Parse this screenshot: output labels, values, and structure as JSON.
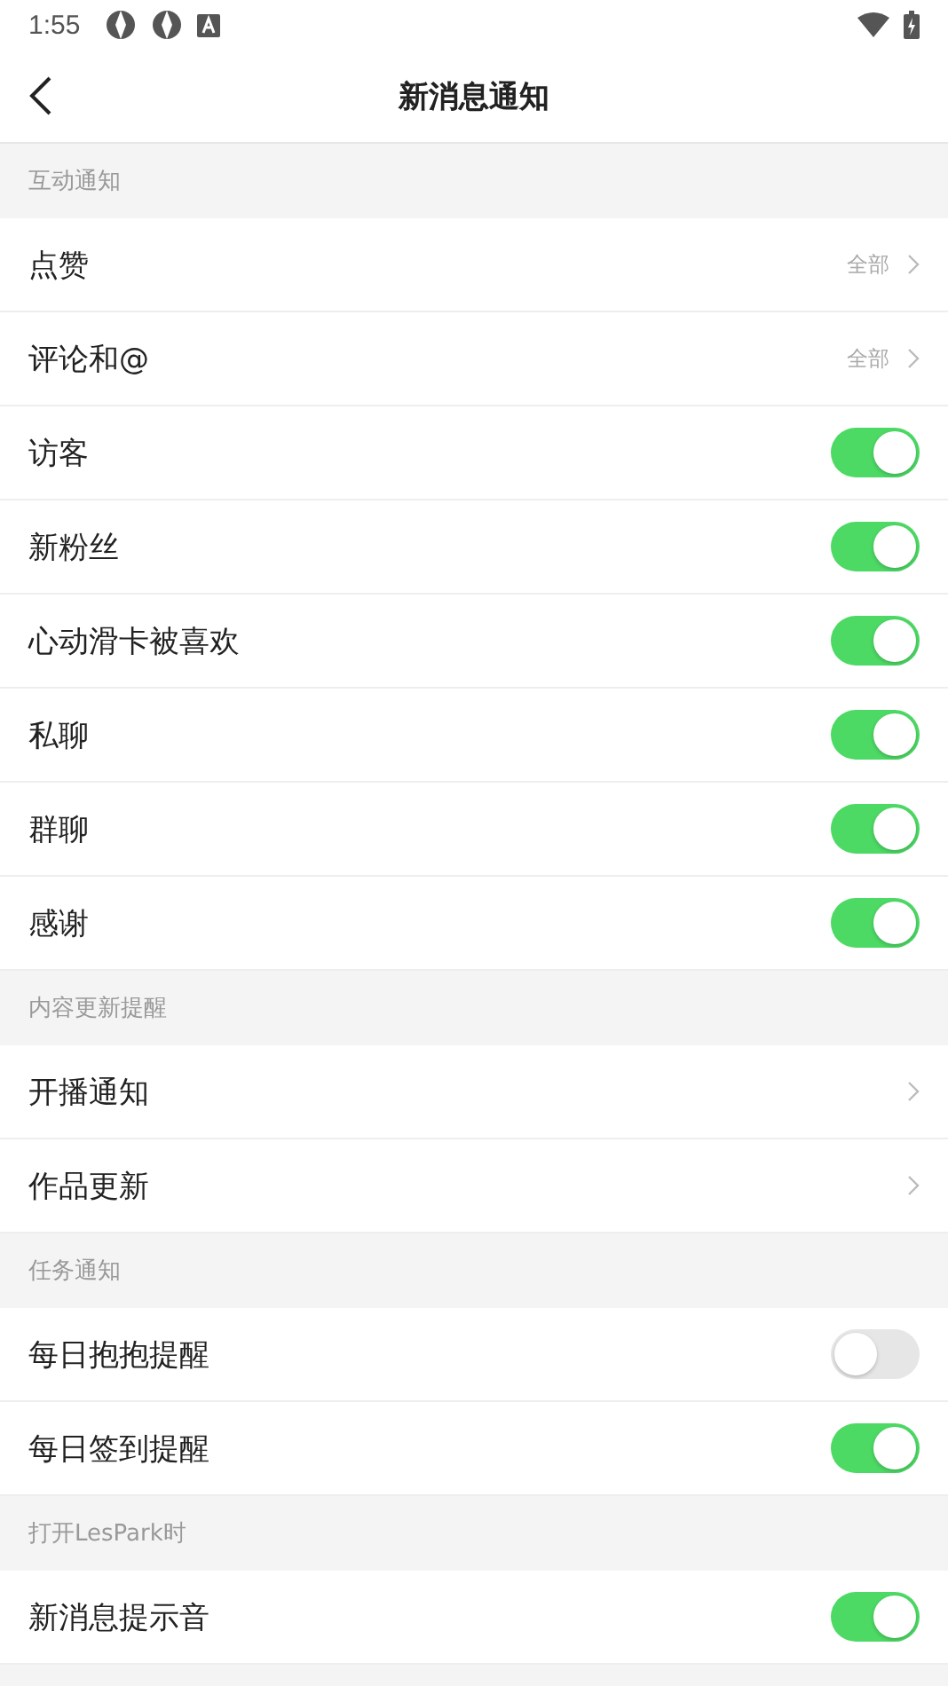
{
  "status_bar": {
    "time": "1:55"
  },
  "header": {
    "title": "新消息通知"
  },
  "sections": [
    {
      "title": "互动通知",
      "rows": [
        {
          "kind": "value",
          "label": "点赞",
          "value": "全部"
        },
        {
          "kind": "value",
          "label": "评论和@",
          "value": "全部"
        },
        {
          "kind": "toggle",
          "label": "访客",
          "on": true
        },
        {
          "kind": "toggle",
          "label": "新粉丝",
          "on": true
        },
        {
          "kind": "toggle",
          "label": "心动滑卡被喜欢",
          "on": true
        },
        {
          "kind": "toggle",
          "label": "私聊",
          "on": true
        },
        {
          "kind": "toggle",
          "label": "群聊",
          "on": true
        },
        {
          "kind": "toggle",
          "label": "感谢",
          "on": true
        }
      ]
    },
    {
      "title": "内容更新提醒",
      "rows": [
        {
          "kind": "link",
          "label": "开播通知"
        },
        {
          "kind": "link",
          "label": "作品更新"
        }
      ]
    },
    {
      "title": "任务通知",
      "rows": [
        {
          "kind": "toggle",
          "label": "每日抱抱提醒",
          "on": false
        },
        {
          "kind": "toggle",
          "label": "每日签到提醒",
          "on": true
        }
      ]
    },
    {
      "title": "打开LesPark时",
      "rows": [
        {
          "kind": "toggle",
          "label": "新消息提示音",
          "on": true
        }
      ]
    }
  ]
}
